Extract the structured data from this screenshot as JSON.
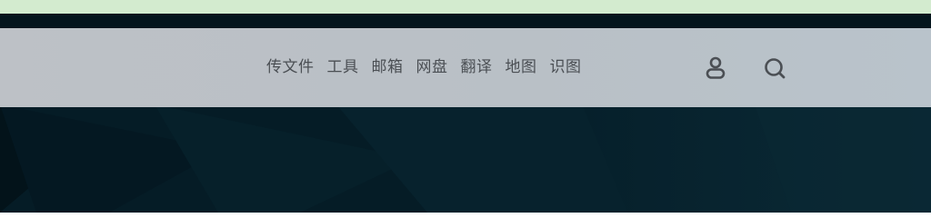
{
  "nav": {
    "items": [
      {
        "label": "传文件"
      },
      {
        "label": "工具"
      },
      {
        "label": "邮箱"
      },
      {
        "label": "网盘"
      },
      {
        "label": "翻译"
      },
      {
        "label": "地图"
      },
      {
        "label": "识图"
      }
    ],
    "user_icon": "user-icon",
    "search_icon": "search-icon"
  },
  "colors": {
    "top_strip": "#d3ebcf",
    "navbar_bg": "#bdc1c6",
    "nav_text": "#4b4f54",
    "background": "#051c26"
  }
}
